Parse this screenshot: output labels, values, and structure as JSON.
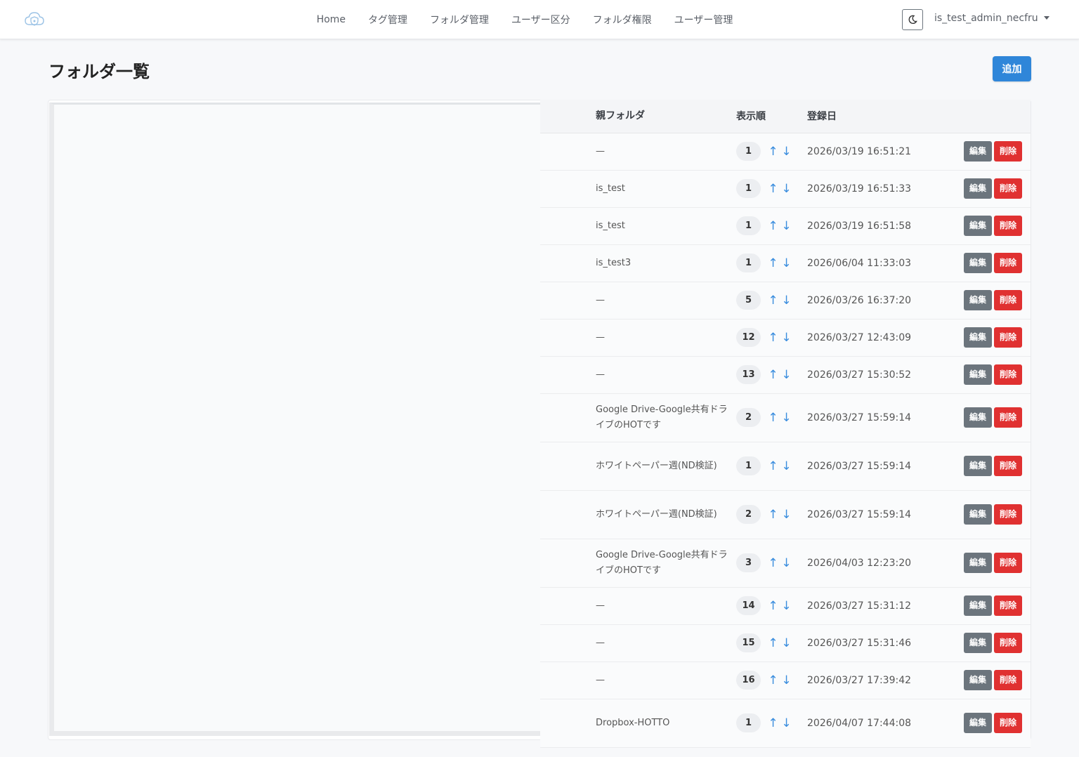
{
  "nav": {
    "links": [
      "Home",
      "タグ管理",
      "フォルダ管理",
      "ユーザー区分",
      "フォルダ権限",
      "ユーザー管理"
    ],
    "user": "is_test_admin_necfru",
    "theme_icon": "moon-icon",
    "logo_icon": "cloud-shield-logo"
  },
  "page": {
    "title": "フォルダ一覧",
    "add_label": "追加"
  },
  "table": {
    "headers": {
      "parent": "親フォルダ",
      "order": "表示順",
      "date": "登録日"
    },
    "arrow_up": "↑",
    "arrow_down": "↓",
    "edit_label": "編集",
    "delete_label": "削除",
    "rows": [
      {
        "parent": "—",
        "order": "1",
        "date": "2026/03/19 16:51:21"
      },
      {
        "parent": "is_test",
        "order": "1",
        "date": "2026/03/19 16:51:33"
      },
      {
        "parent": "is_test",
        "order": "1",
        "date": "2026/03/19 16:51:58"
      },
      {
        "parent": "is_test3",
        "order": "1",
        "date": "2026/06/04 11:33:03"
      },
      {
        "parent": "—",
        "order": "5",
        "date": "2026/03/26 16:37:20"
      },
      {
        "parent": "—",
        "order": "12",
        "date": "2026/03/27 12:43:09"
      },
      {
        "parent": "—",
        "order": "13",
        "date": "2026/03/27 15:30:52"
      },
      {
        "parent": "Google Drive-Google共有ドライブのHOTです",
        "order": "2",
        "date": "2026/03/27 15:59:14"
      },
      {
        "parent": "ホワイトペーパー週(ND検証)",
        "order": "1",
        "date": "2026/03/27 15:59:14"
      },
      {
        "parent": "ホワイトペーパー週(ND検証)",
        "order": "2",
        "date": "2026/03/27 15:59:14"
      },
      {
        "parent": "Google Drive-Google共有ドライブのHOTです",
        "order": "3",
        "date": "2026/04/03 12:23:20"
      },
      {
        "parent": "—",
        "order": "14",
        "date": "2026/03/27 15:31:12"
      },
      {
        "parent": "—",
        "order": "15",
        "date": "2026/03/27 15:31:46"
      },
      {
        "parent": "—",
        "order": "16",
        "date": "2026/03/27 17:39:42"
      },
      {
        "parent": "Dropbox-HOTTO",
        "order": "1",
        "date": "2026/04/07 17:44:08"
      }
    ]
  },
  "colors": {
    "primary": "#2f86d9",
    "danger": "#e03131",
    "secondary": "#6c757d",
    "arrow": "#3a8dde"
  }
}
